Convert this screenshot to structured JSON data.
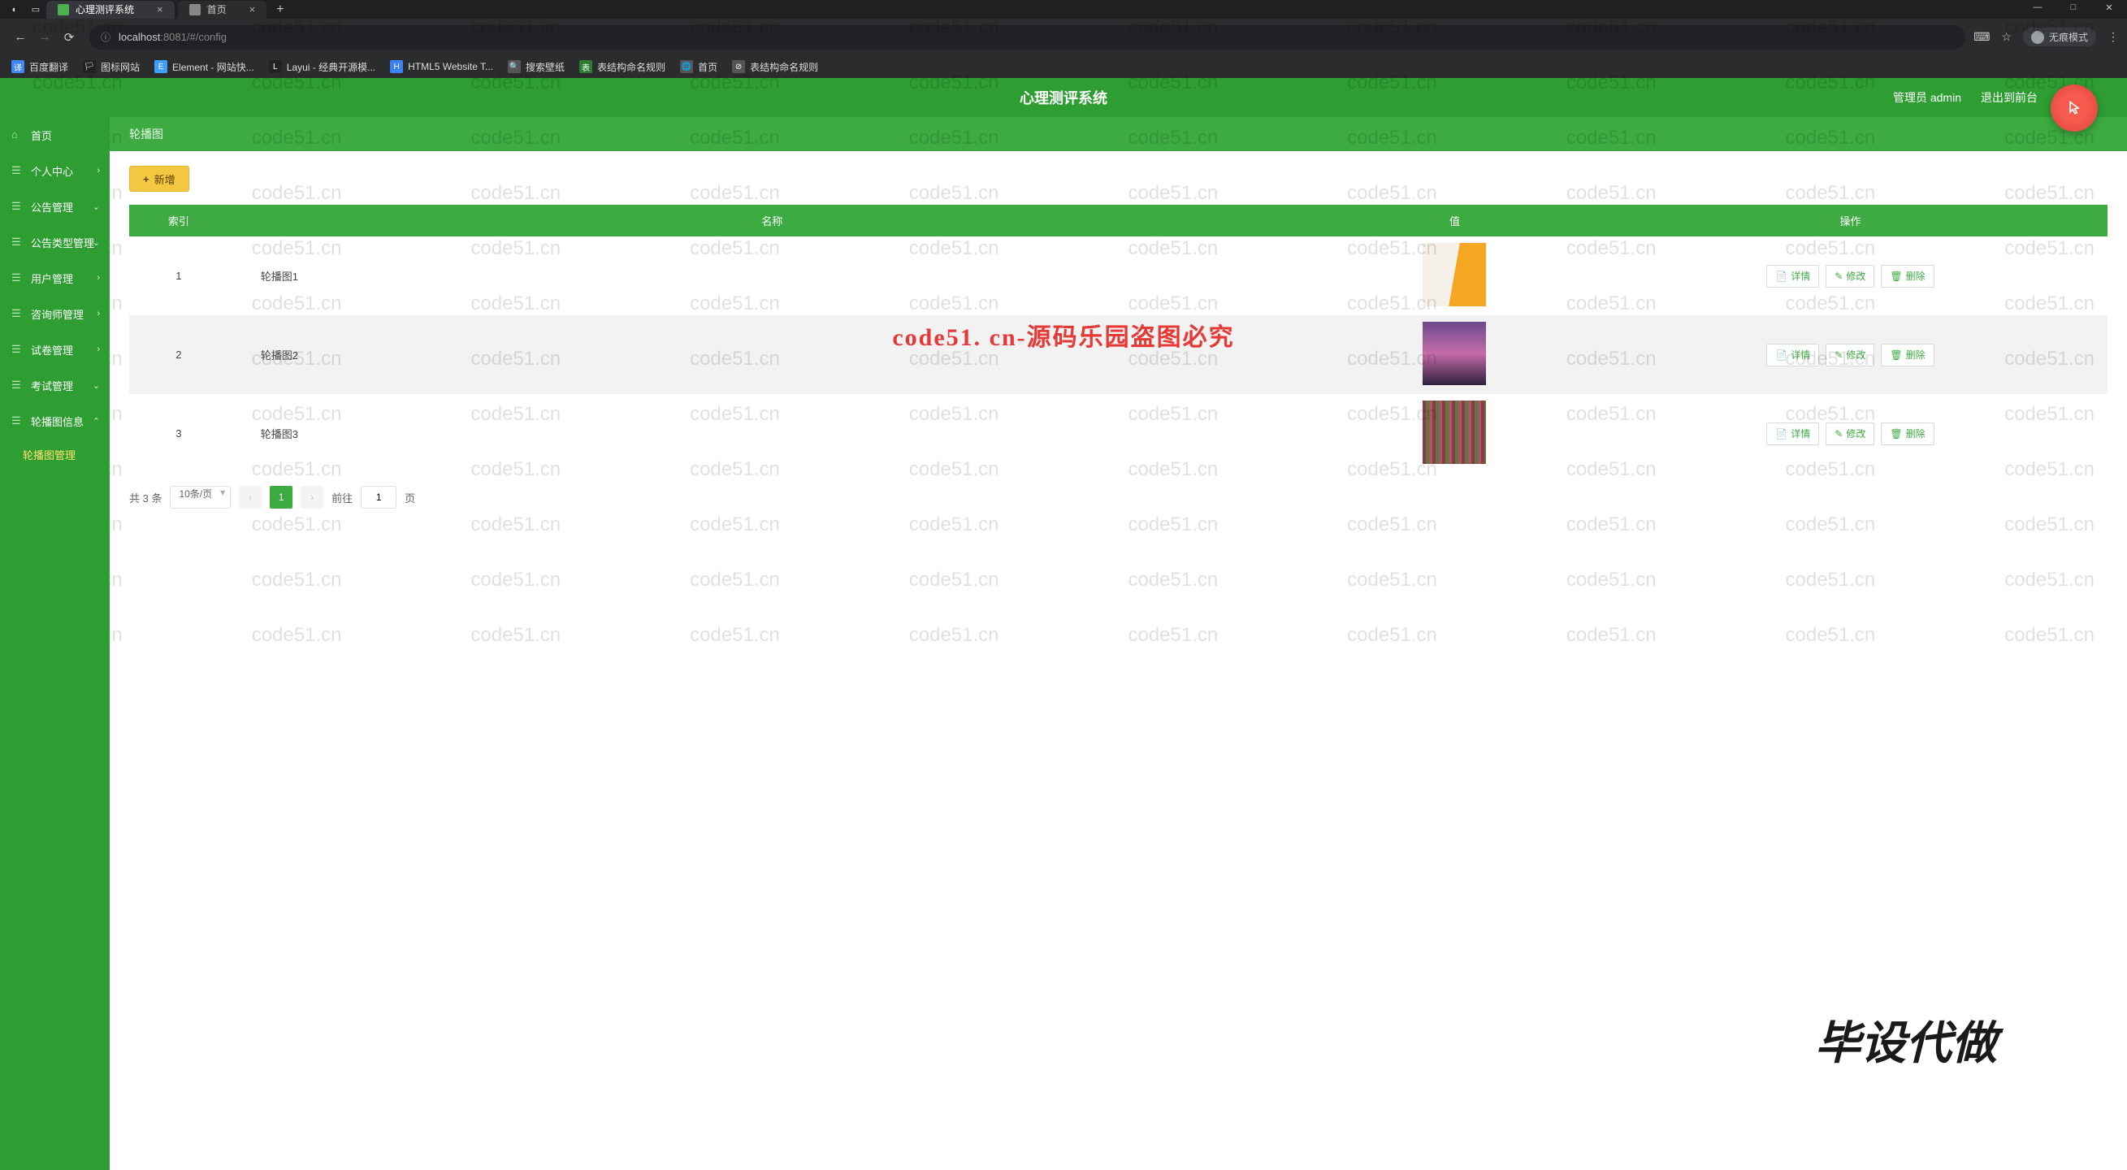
{
  "chrome": {
    "tabs": [
      {
        "label": "心理测评系统",
        "active": true,
        "color": "#4caf50"
      },
      {
        "label": "首页",
        "active": false,
        "color": "#888"
      }
    ],
    "url_host": "localhost",
    "url_port": ":8081",
    "url_path": "/#/config",
    "incognito": "无痕模式",
    "win": {
      "min": "—",
      "max": "□",
      "close": "✕"
    }
  },
  "bookmarks": [
    {
      "label": "百度翻译",
      "bg": "#4285f4",
      "ico": "译"
    },
    {
      "label": "图标网站",
      "bg": "#222",
      "ico": "🏳"
    },
    {
      "label": "Element - 网站快...",
      "bg": "#409eff",
      "ico": "E"
    },
    {
      "label": "Layui - 经典开源模...",
      "bg": "#222",
      "ico": "L"
    },
    {
      "label": "HTML5 Website T...",
      "bg": "#3b82f6",
      "ico": "H"
    },
    {
      "label": "搜索壁纸",
      "bg": "#555",
      "ico": "🔍"
    },
    {
      "label": "表结构命名规则",
      "bg": "#2e7d32",
      "ico": "表"
    },
    {
      "label": "首页",
      "bg": "#555",
      "ico": "🌐"
    },
    {
      "label": "表结构命名规则",
      "bg": "#555",
      "ico": "⊘"
    }
  ],
  "header": {
    "title": "心理测评系统",
    "admin": "管理员 admin",
    "logout": "退出到前台"
  },
  "sidebar": {
    "items": [
      {
        "label": "首页",
        "expand": ""
      },
      {
        "label": "个人中心",
        "expand": "›"
      },
      {
        "label": "公告管理",
        "expand": "⌄"
      },
      {
        "label": "公告类型管理",
        "expand": "⌄"
      },
      {
        "label": "用户管理",
        "expand": "›"
      },
      {
        "label": "咨询师管理",
        "expand": "›"
      },
      {
        "label": "试卷管理",
        "expand": "›"
      },
      {
        "label": "考试管理",
        "expand": "⌄"
      },
      {
        "label": "轮播图信息",
        "expand": "⌃"
      }
    ],
    "sub": "轮播图管理"
  },
  "toolbar": {
    "breadcrumb": "轮播图",
    "add_label": "新增",
    "add_plus": "+"
  },
  "table": {
    "headers": {
      "idx": "索引",
      "name": "名称",
      "val": "值",
      "ops": "操作"
    },
    "rows": [
      {
        "idx": "1",
        "name": "轮播图1",
        "thumb": "t1"
      },
      {
        "idx": "2",
        "name": "轮播图2",
        "thumb": "t2"
      },
      {
        "idx": "3",
        "name": "轮播图3",
        "thumb": "t3"
      }
    ],
    "actions": {
      "detail": "详情",
      "edit": "修改",
      "del": "删除"
    }
  },
  "pagination": {
    "total": "共 3 条",
    "per": "10条/页",
    "prev": "‹",
    "cur": "1",
    "next": "›",
    "goto_pre": "前往",
    "goto_val": "1",
    "goto_suf": "页"
  },
  "watermark": "code51.cn",
  "red_mark": "code51. cn-源码乐园盗图必究",
  "big_text": "毕设代做"
}
